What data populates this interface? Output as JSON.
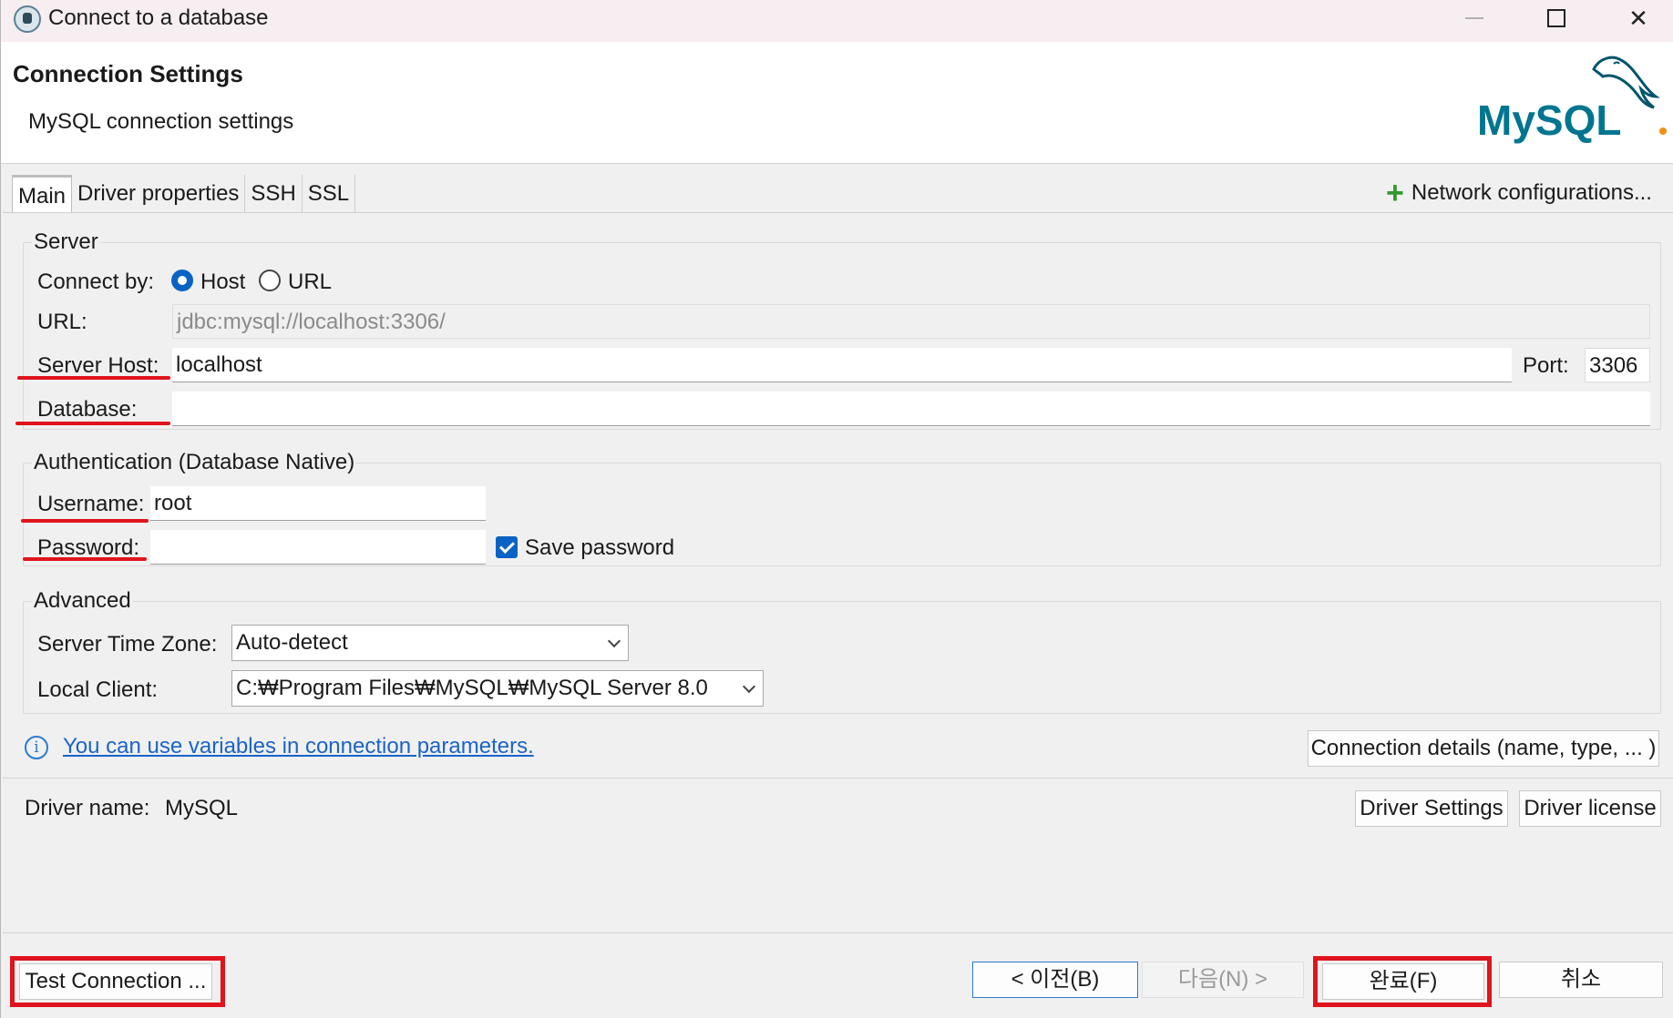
{
  "window": {
    "title": "Connect to a database",
    "icon": "dbeaver-app-icon"
  },
  "header": {
    "title": "Connection Settings",
    "subtitle": "MySQL connection settings",
    "logo_text": "MySQL"
  },
  "tabs": [
    {
      "label": "Main",
      "active": true
    },
    {
      "label": "Driver properties",
      "active": false
    },
    {
      "label": "SSH",
      "active": false
    },
    {
      "label": "SSL",
      "active": false
    }
  ],
  "network_config_label": "Network configurations...",
  "server": {
    "group_title": "Server",
    "connect_by_label": "Connect by:",
    "host_option": "Host",
    "url_option": "URL",
    "selected": "Host",
    "url_label": "URL:",
    "url_value": "jdbc:mysql://localhost:3306/",
    "host_label": "Server Host:",
    "host_value": "localhost",
    "port_label": "Port:",
    "port_value": "3306",
    "database_label": "Database:",
    "database_value": ""
  },
  "auth": {
    "group_title": "Authentication (Database Native)",
    "username_label": "Username:",
    "username_value": "root",
    "password_label": "Password:",
    "password_value": "",
    "save_password_label": "Save password",
    "save_password_checked": true
  },
  "advanced": {
    "group_title": "Advanced",
    "timezone_label": "Server Time Zone:",
    "timezone_value": "Auto-detect",
    "local_client_label": "Local Client:",
    "local_client_value": "C:₩Program Files₩MySQL₩MySQL Server 8.0"
  },
  "variables_link": "You can use variables in connection parameters.",
  "connection_details_button": "Connection details (name, type, ... )",
  "driver": {
    "name_label": "Driver name:",
    "name_value": "MySQL",
    "settings_button": "Driver Settings",
    "license_button": "Driver license"
  },
  "footer": {
    "test_connection": "Test Connection ...",
    "back": "< 이전(B)",
    "next": "다음(N) >",
    "finish": "완료(F)",
    "cancel": "취소"
  },
  "colors": {
    "highlight_red": "#e0141c",
    "accent_blue": "#0a63c4",
    "link_blue": "#1a64c8",
    "mysql_teal": "#00758f",
    "mysql_orange": "#f29111"
  }
}
